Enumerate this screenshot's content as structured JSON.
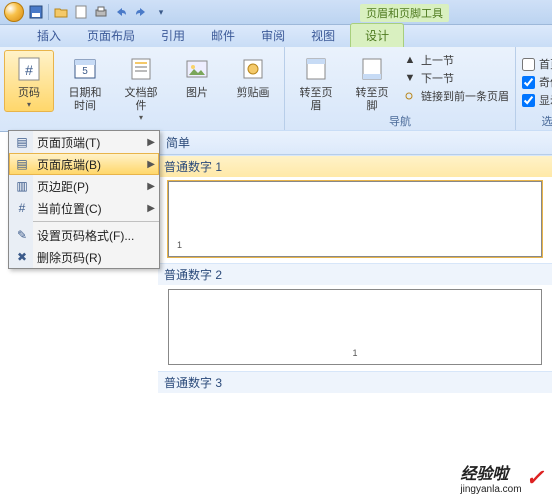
{
  "context_tool_title": "页眉和页脚工具",
  "tabs": {
    "insert": "插入",
    "layout": "页面布局",
    "references": "引用",
    "mail": "邮件",
    "review": "审阅",
    "view": "视图",
    "design": "设计"
  },
  "ribbon": {
    "page_number_btn": "页码",
    "date_time_btn": "日期和\n时间",
    "doc_parts_btn": "文档部件",
    "picture_btn": "图片",
    "clipart_btn": "剪贴画",
    "goto_header_btn": "转至页眉",
    "goto_footer_btn": "转至页脚",
    "prev_section": "上一节",
    "next_section": "下一节",
    "link_prev": "链接到前一条页眉",
    "nav_group": "导航",
    "first_diff": "首页不同",
    "odd_even_diff": "奇偶页不",
    "show_doc": "显示文栏",
    "options_group": "选项"
  },
  "dropdown": {
    "top": "页面顶端(T)",
    "bottom": "页面底端(B)",
    "margins": "页边距(P)",
    "current": "当前位置(C)",
    "format": "设置页码格式(F)...",
    "remove": "删除页码(R)"
  },
  "gallery": {
    "header": "简单",
    "item1": "普通数字 1",
    "item2": "普通数字 2",
    "item3": "普通数字 3",
    "pagenum": "1"
  },
  "watermark": {
    "brand": "经验啦",
    "url": "jingyanla.com"
  },
  "chk": {
    "odd_even": true,
    "show": true,
    "first": false
  }
}
